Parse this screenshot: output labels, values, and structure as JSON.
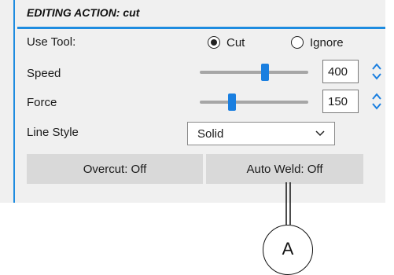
{
  "panel": {
    "title": "EDITING ACTION: cut",
    "accent_color": "#1e8ce0"
  },
  "use_tool": {
    "label": "Use Tool:",
    "options": [
      {
        "label": "Cut",
        "selected": true
      },
      {
        "label": "Ignore",
        "selected": false
      }
    ]
  },
  "speed": {
    "label": "Speed",
    "value": "400",
    "slider_fraction": 0.6
  },
  "force": {
    "label": "Force",
    "value": "150",
    "slider_fraction": 0.3
  },
  "line_style": {
    "label": "Line Style",
    "selected": "Solid"
  },
  "buttons": {
    "overcut": "Overcut: Off",
    "auto_weld": "Auto Weld: Off"
  },
  "callout": {
    "letter": "A"
  },
  "icons": {
    "spinner": "up-down-arrows-icon",
    "dropdown": "chevron-down-icon"
  }
}
